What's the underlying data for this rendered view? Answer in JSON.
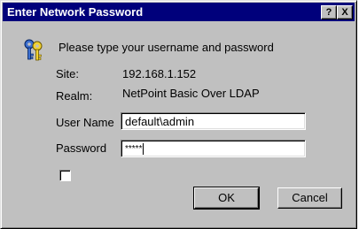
{
  "window": {
    "title": "Enter Network Password",
    "help_label": "?",
    "close_label": "X"
  },
  "prompt": "Please type your username and password",
  "site": {
    "label": "Site:",
    "value": "192.168.1.152"
  },
  "realm": {
    "label": "Realm:",
    "value": "NetPoint Basic Over LDAP"
  },
  "username": {
    "label": "User Name",
    "value": "default\\admin"
  },
  "password": {
    "label": "Password",
    "masked_value": "*****"
  },
  "remember_checkbox": {
    "checked": false
  },
  "buttons": {
    "ok": "OK",
    "cancel": "Cancel"
  },
  "colors": {
    "titlebar": "#00007b",
    "face": "#c0c0c0",
    "title_text": "#ffffff"
  },
  "icons": {
    "prompt_icon": "keys-icon"
  }
}
